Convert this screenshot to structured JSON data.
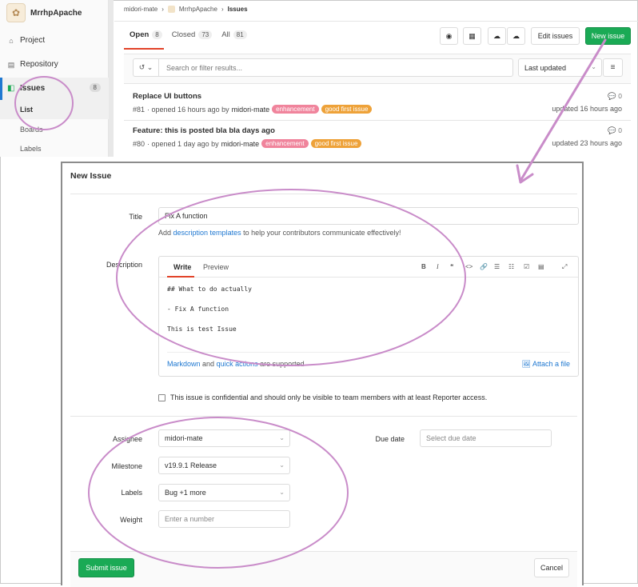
{
  "project": {
    "name": "MrrhpApache"
  },
  "sidebar": {
    "project": "Project",
    "repository": "Repository",
    "issues": "Issues",
    "issues_count": "8",
    "list": "List",
    "boards": "Boards",
    "labels": "Labels"
  },
  "breadcrumb": {
    "user": "midori-mate",
    "project": "MrrhpApache",
    "current": "Issues"
  },
  "tabs": {
    "open": "Open",
    "open_count": "8",
    "closed": "Closed",
    "closed_count": "73",
    "all": "All",
    "all_count": "81"
  },
  "toolbar": {
    "edit_issues": "Edit issues",
    "new_issue": "New issue"
  },
  "filter": {
    "placeholder": "Search or filter results...",
    "sort": "Last updated"
  },
  "issues": [
    {
      "title": "Replace UI buttons",
      "ref": "#81",
      "opened": "· opened 16 hours ago by",
      "author": "midori-mate",
      "labels": [
        "enhancement",
        "good first issue"
      ],
      "comments": "0",
      "updated": "updated 16 hours ago"
    },
    {
      "title": "Feature: this is posted bla bla days ago",
      "ref": "#80",
      "opened": "· opened 1 day ago by",
      "author": "midori-mate",
      "labels": [
        "enhancement",
        "good first issue"
      ],
      "comments": "0",
      "updated": "updated 23 hours ago"
    }
  ],
  "modal": {
    "title": "New Issue",
    "title_label": "Title",
    "title_value": "Fix A function",
    "hint_prefix": "Add",
    "hint_link": "description templates",
    "hint_suffix": "to help your contributors communicate effectively!",
    "description_label": "Description",
    "write_tab": "Write",
    "preview_tab": "Preview",
    "body_lines": [
      "## What to do actually",
      "- Fix A function",
      "This is test Issue"
    ],
    "markdown_link": "Markdown",
    "and": "and",
    "quick_actions_link": "quick actions",
    "supported": "are supported",
    "attach": "Attach a file",
    "confidential": "This issue is confidential and should only be visible to team members with at least Reporter access.",
    "assignee_label": "Assignee",
    "assignee_value": "midori-mate",
    "milestone_label": "Milestone",
    "milestone_value": "v19.9.1 Release",
    "labels_label": "Labels",
    "labels_value": "Bug +1 more",
    "weight_label": "Weight",
    "weight_placeholder": "Enter a number",
    "due_label": "Due date",
    "due_placeholder": "Select due date",
    "submit": "Submit issue",
    "cancel": "Cancel"
  },
  "colors": {
    "green": "#1aaa55",
    "annotation": "#c98cc9",
    "label_pink": "#f0849c",
    "label_orange": "#eea239",
    "link": "#1f78d1"
  }
}
